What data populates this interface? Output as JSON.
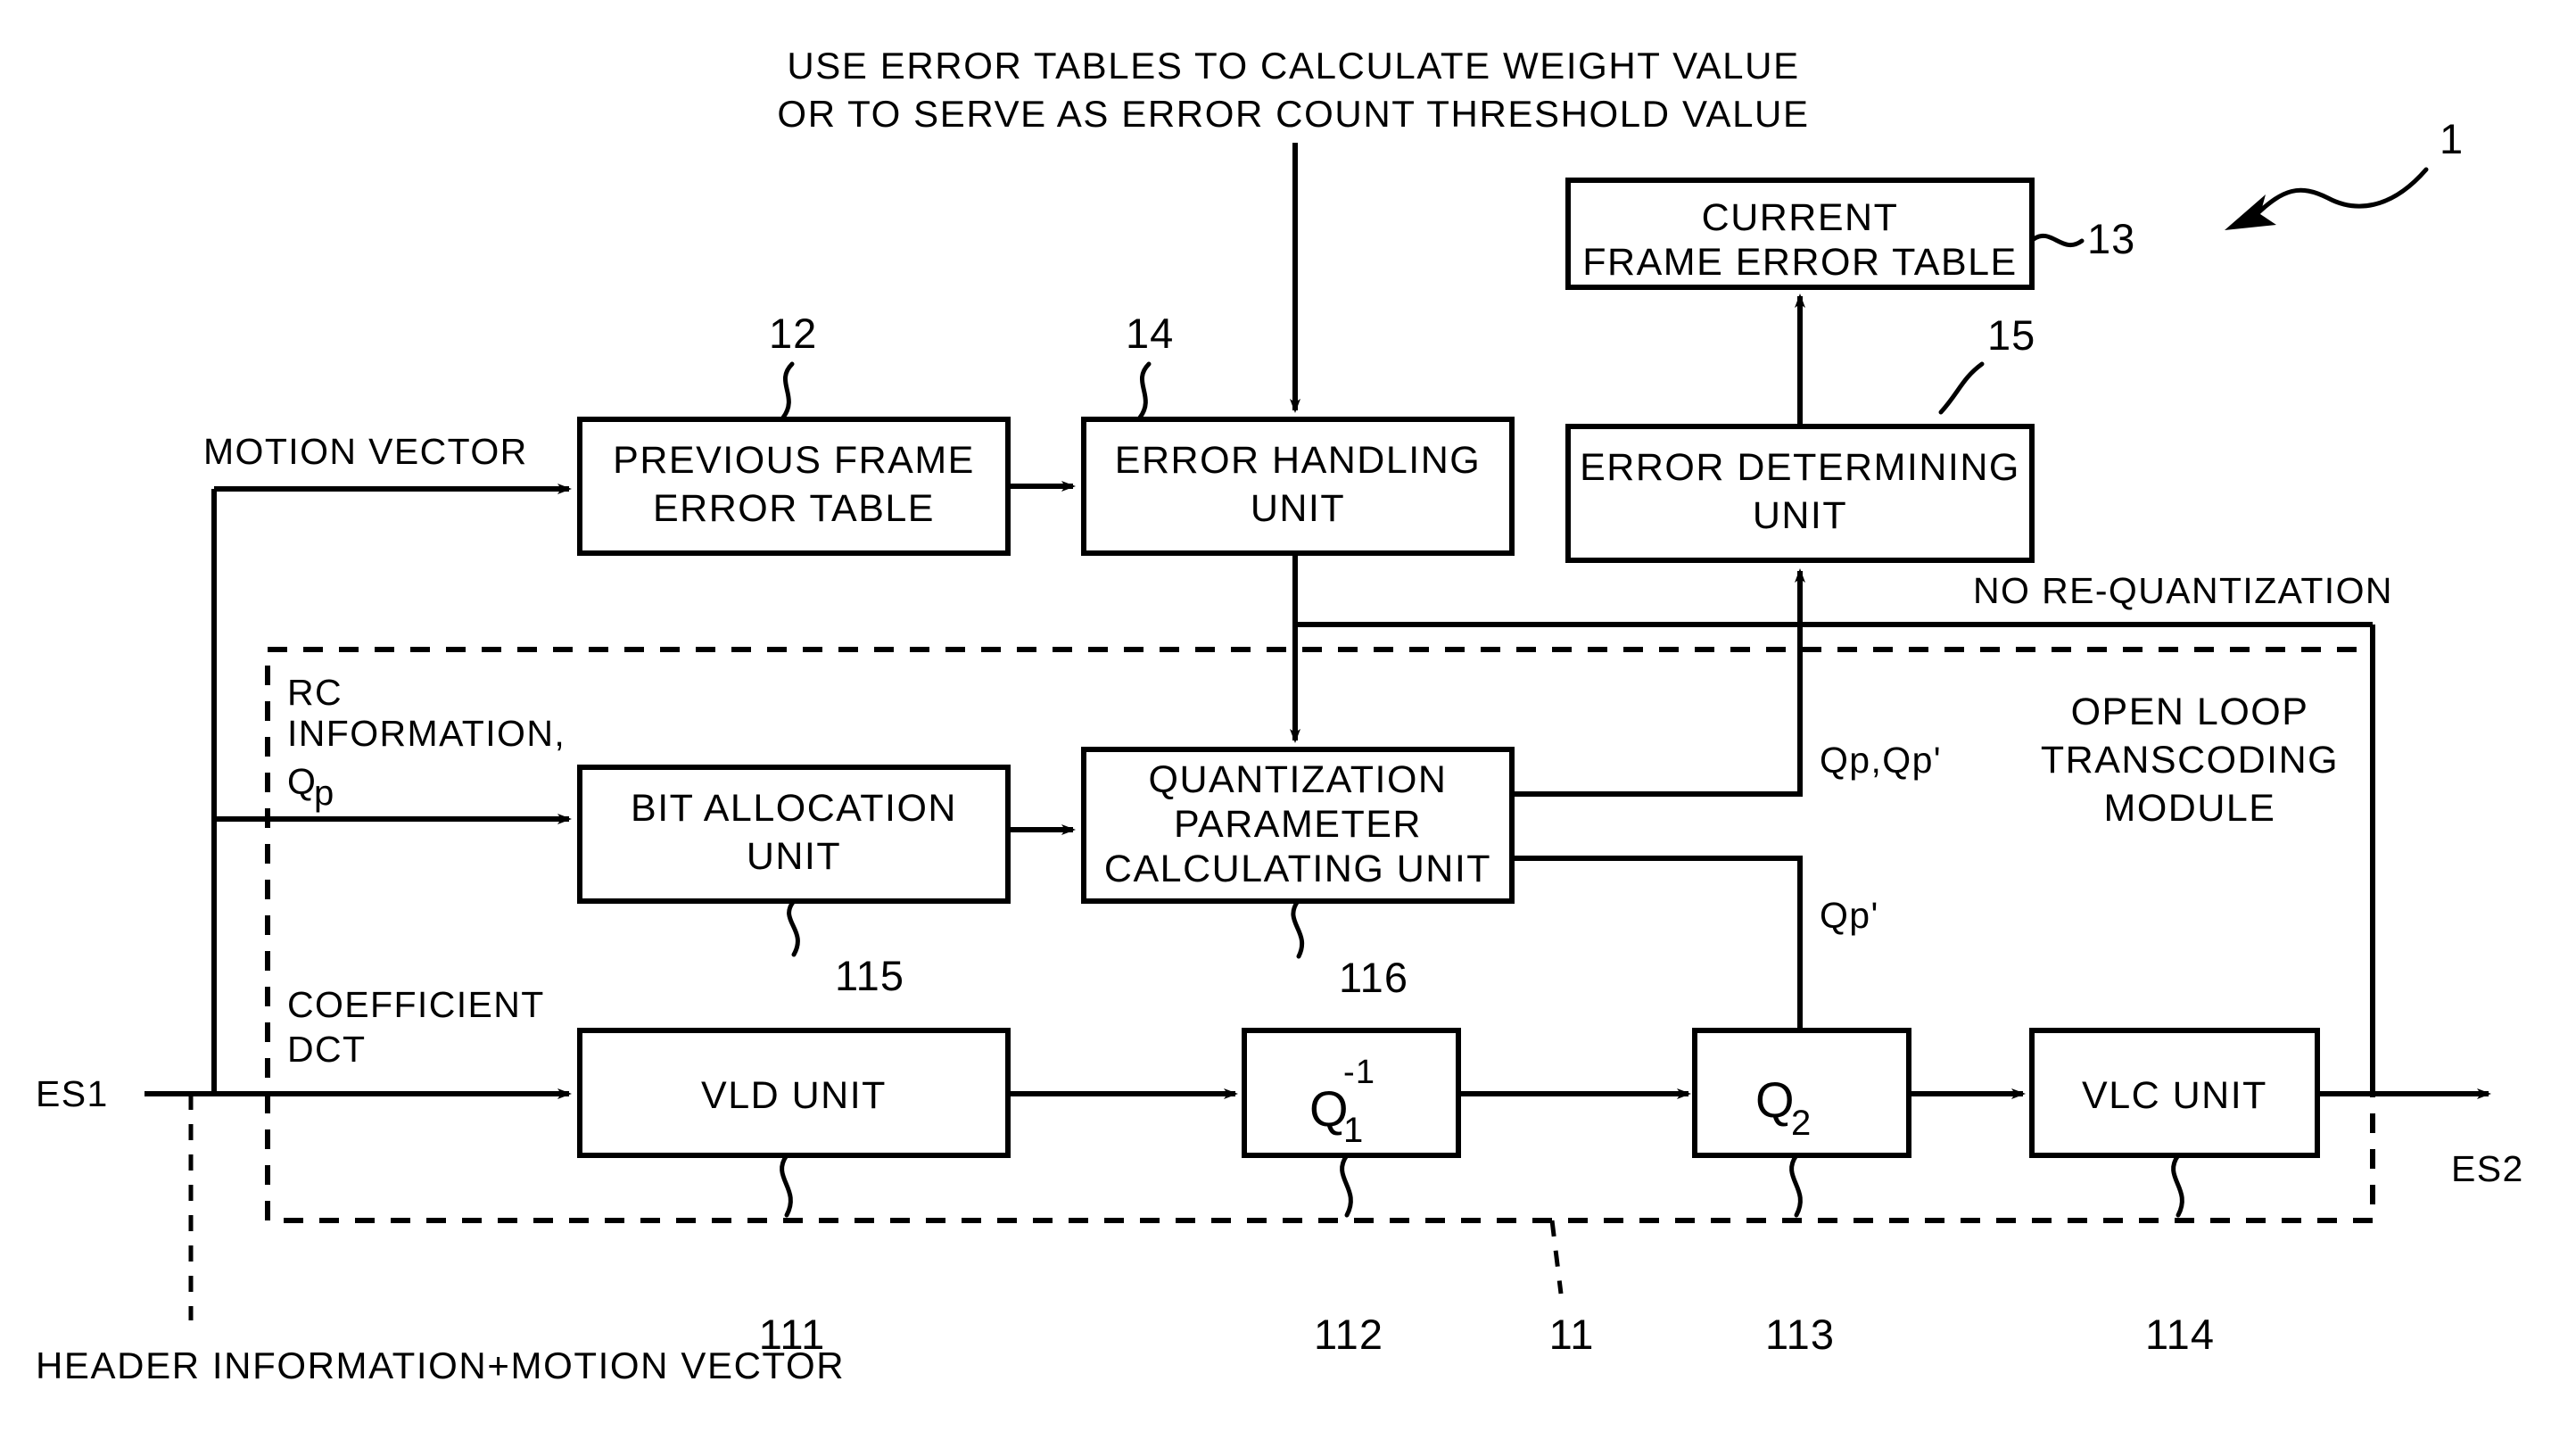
{
  "figure": {
    "top_caption_line1": "USE ERROR TABLES TO CALCULATE WEIGHT VALUE",
    "top_caption_line2": "OR TO SERVE AS ERROR COUNT THRESHOLD VALUE",
    "bottom_caption": "HEADER INFORMATION+MOTION VECTOR",
    "figure_ref": "1"
  },
  "boxes": {
    "previous_frame_error_table": {
      "line1": "PREVIOUS FRAME",
      "line2": "ERROR TABLE",
      "ref": "12"
    },
    "error_handling_unit": {
      "line1": "ERROR HANDLING",
      "line2": "UNIT",
      "ref": "14"
    },
    "current_frame_error_table": {
      "line1": "CURRENT",
      "line2": "FRAME ERROR TABLE",
      "ref": "13"
    },
    "error_determining_unit": {
      "line1": "ERROR DETERMINING",
      "line2": "UNIT",
      "ref": "15"
    },
    "bit_allocation_unit": {
      "line1": "BIT ALLOCATION",
      "line2": "UNIT",
      "ref": "115"
    },
    "quantization_parameter_calculating_unit": {
      "line1": "QUANTIZATION",
      "line2": "PARAMETER",
      "line3": "CALCULATING UNIT",
      "ref": "116"
    },
    "vld_unit": {
      "label": "VLD UNIT",
      "ref": "111"
    },
    "inverse_quantizer": {
      "base": "Q",
      "sub": "1",
      "sup": "-1",
      "ref": "112"
    },
    "quantizer_2": {
      "base": "Q",
      "sub": "2",
      "ref": "113"
    },
    "vlc_unit": {
      "label": "VLC UNIT",
      "ref": "114"
    }
  },
  "module": {
    "label_line1": "OPEN LOOP",
    "label_line2": "TRANSCODING",
    "label_line3": "MODULE",
    "ref": "11"
  },
  "signals": {
    "motion_vector": "MOTION VECTOR",
    "rc_information_line1": "RC",
    "rc_information_line2": "INFORMATION,",
    "rc_information_qp_base": "Q",
    "rc_information_qp_sub": "p",
    "coefficient_line1": "COEFFICIENT",
    "coefficient_line2": "DCT",
    "no_requantization": "NO RE-QUANTIZATION",
    "qp_qp_prime": "Qp,Qp'",
    "qp_prime": "Qp'",
    "es1": "ES1",
    "es2": "ES2"
  }
}
